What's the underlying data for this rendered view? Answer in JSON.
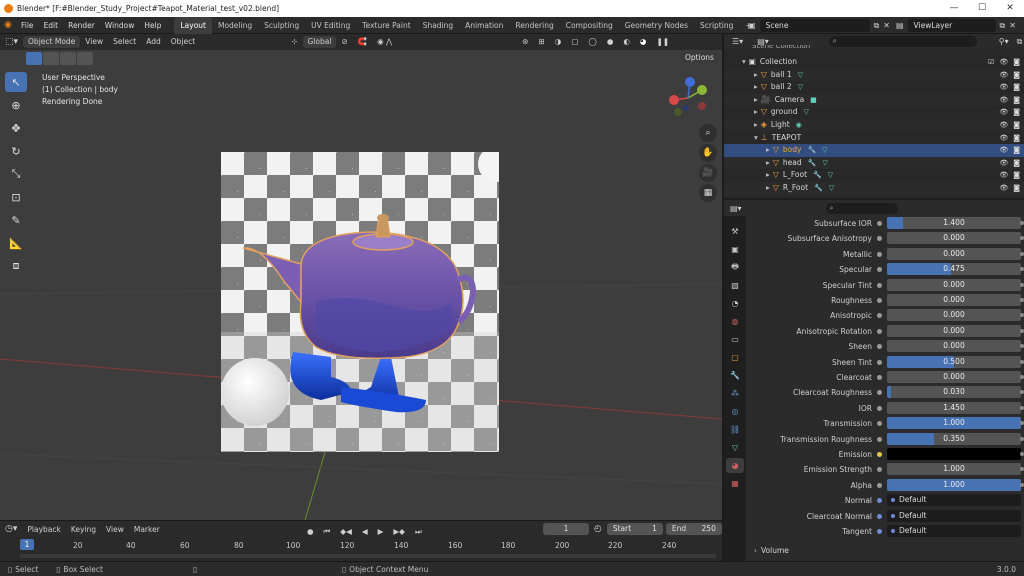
{
  "window": {
    "title": "Blender* [F:#Blender_Study_Project#Teapot_Material_test_v02.blend]",
    "minimize": "—",
    "maximize": "☐",
    "close": "✕"
  },
  "menubar": {
    "menus": [
      "File",
      "Edit",
      "Render",
      "Window",
      "Help"
    ],
    "workspaces": [
      "Layout",
      "Modeling",
      "Sculpting",
      "UV Editing",
      "Texture Paint",
      "Shading",
      "Animation",
      "Rendering",
      "Compositing",
      "Geometry Nodes",
      "Scripting"
    ],
    "active_workspace": "Layout",
    "add_workspace": "+",
    "scene": "Scene",
    "view_layer": "ViewLayer"
  },
  "viewport": {
    "mode": "Object Mode",
    "menus": [
      "View",
      "Select",
      "Add",
      "Object"
    ],
    "transform_orientation": "Global",
    "options": "Options",
    "info_lines": [
      "User Perspective",
      "(1) Collection | body",
      "Rendering Done"
    ]
  },
  "timeline": {
    "menus": [
      "Playback",
      "Keying",
      "View",
      "Marker"
    ],
    "current_frame": "1",
    "start_label": "Start",
    "start": "1",
    "end_label": "End",
    "end": "250",
    "ticks": [
      "20",
      "40",
      "60",
      "80",
      "100",
      "120",
      "140",
      "160",
      "180",
      "200",
      "220",
      "240"
    ]
  },
  "statusbar": {
    "select": "Select",
    "box_select": "Box Select",
    "context_menu": "Object Context Menu",
    "version": "3.0.0"
  },
  "outliner": {
    "top_cut": "Scene Collection",
    "rows": [
      {
        "label": "Collection",
        "indent": 0
      },
      {
        "label": "ball 1",
        "indent": 1
      },
      {
        "label": "ball 2",
        "indent": 1
      },
      {
        "label": "Camera",
        "indent": 1
      },
      {
        "label": "ground",
        "indent": 1
      },
      {
        "label": "Light",
        "indent": 1
      },
      {
        "label": "TEAPOT",
        "indent": 1
      },
      {
        "label": "body",
        "indent": 2
      },
      {
        "label": "head",
        "indent": 2
      },
      {
        "label": "L_Foot",
        "indent": 2
      },
      {
        "label": "R_Foot",
        "indent": 2
      }
    ]
  },
  "properties": {
    "rows": [
      {
        "label": "Subsurface IOR",
        "value": "1.400",
        "fill": 0.12
      },
      {
        "label": "Subsurface Anisotropy",
        "value": "0.000",
        "fill": 0
      },
      {
        "label": "Metallic",
        "value": "0.000",
        "fill": 0
      },
      {
        "label": "Specular",
        "value": "0.475",
        "fill": 0.475
      },
      {
        "label": "Specular Tint",
        "value": "0.000",
        "fill": 0
      },
      {
        "label": "Roughness",
        "value": "0.000",
        "fill": 0
      },
      {
        "label": "Anisotropic",
        "value": "0.000",
        "fill": 0
      },
      {
        "label": "Anisotropic Rotation",
        "value": "0.000",
        "fill": 0
      },
      {
        "label": "Sheen",
        "value": "0.000",
        "fill": 0
      },
      {
        "label": "Sheen Tint",
        "value": "0.500",
        "fill": 0.5
      },
      {
        "label": "Clearcoat",
        "value": "0.000",
        "fill": 0
      },
      {
        "label": "Clearcoat Roughness",
        "value": "0.030",
        "fill": 0.03
      },
      {
        "label": "IOR",
        "value": "1.450",
        "fill": 0
      },
      {
        "label": "Transmission",
        "value": "1.000",
        "fill": 1.0
      },
      {
        "label": "Transmission Roughness",
        "value": "0.350",
        "fill": 0.35
      },
      {
        "label": "Emission",
        "value": "",
        "fill": 0
      },
      {
        "label": "Emission Strength",
        "value": "1.000",
        "fill": 0
      },
      {
        "label": "Alpha",
        "value": "1.000",
        "fill": 1.0
      },
      {
        "label": "Normal",
        "value": "Default",
        "fill": 0
      },
      {
        "label": "Clearcoat Normal",
        "value": "Default",
        "fill": 0
      },
      {
        "label": "Tangent",
        "value": "Default",
        "fill": 0
      }
    ],
    "volume": "Volume"
  },
  "colors": {
    "accent": "#4772b3",
    "selection": "#334d80",
    "object_orange": "#f2a040",
    "mesh_teal": "#5bd1b8"
  }
}
